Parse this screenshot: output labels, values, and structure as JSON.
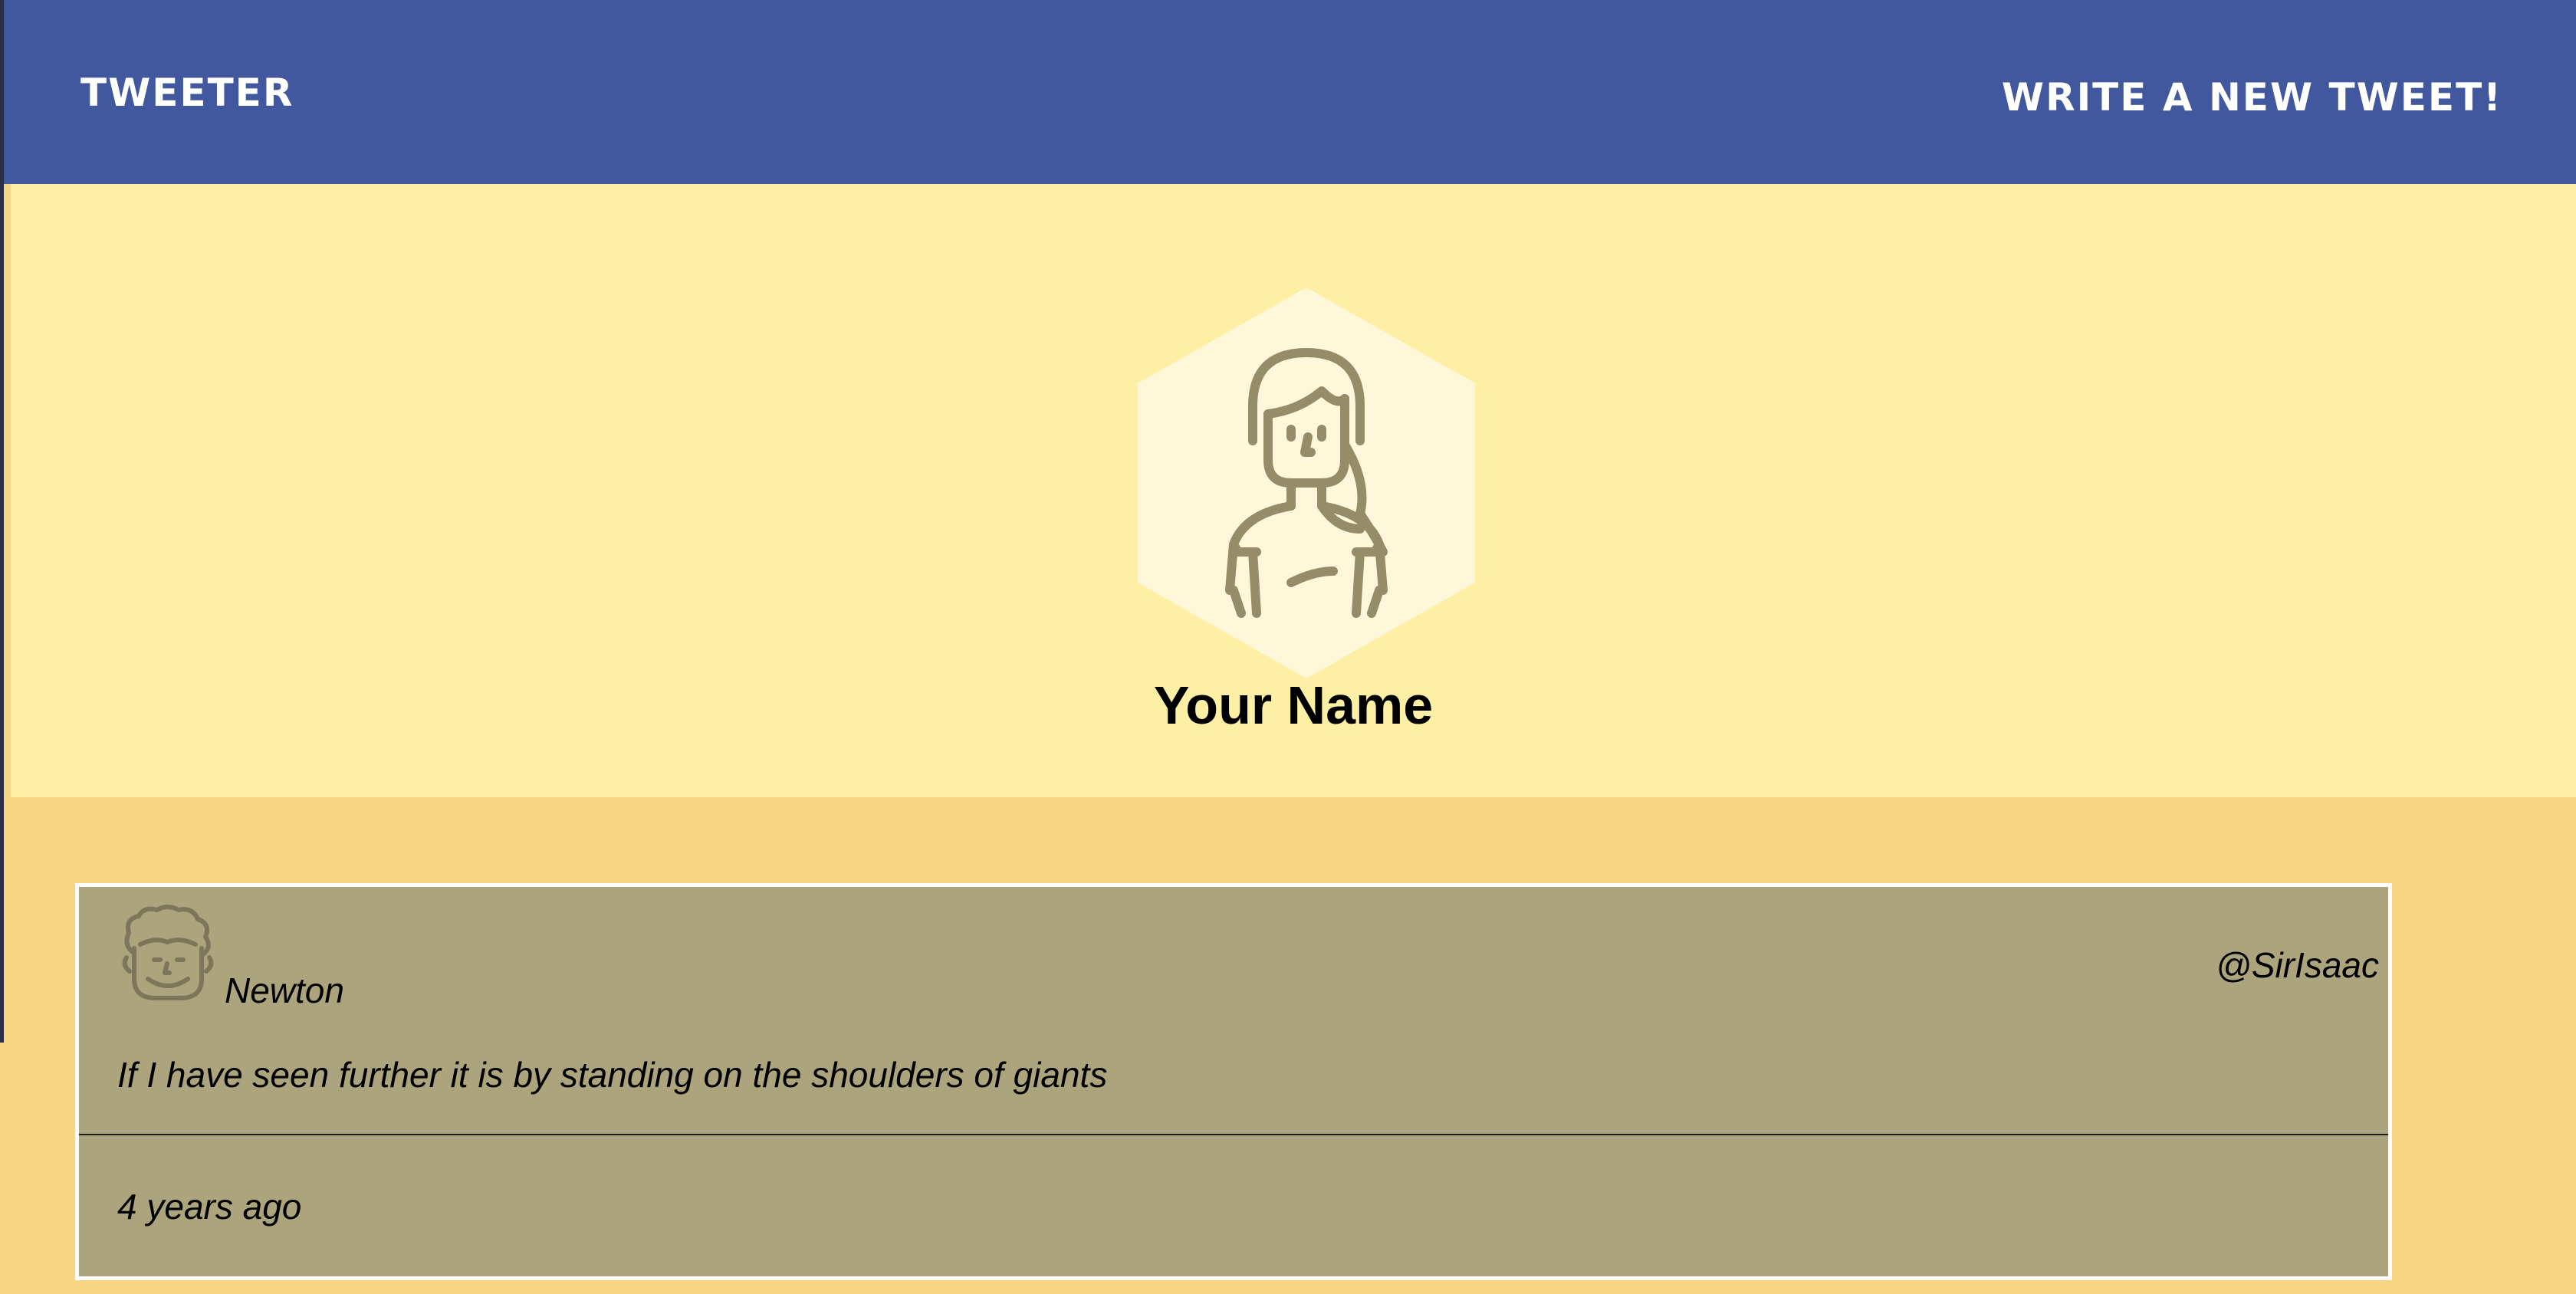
{
  "nav": {
    "brand": "Tweeter",
    "write_link": "Write a new tweet!"
  },
  "profile": {
    "name": "Your Name",
    "avatar_icon": "woman-avatar-icon"
  },
  "tweet": {
    "avatar_icon": "man-curly-hair-avatar-icon",
    "author": "Newton",
    "handle": "@SirIsaac",
    "body": "If I have seen further it is by standing on the shoulders of giants",
    "time": "4 years ago"
  },
  "colors": {
    "nav_bg": "#42589e",
    "profile_bg": "#fdf0a4",
    "page_bg": "#f8d583",
    "tweet_bg": "#aba47c",
    "icon_stroke": "#958c6a"
  }
}
